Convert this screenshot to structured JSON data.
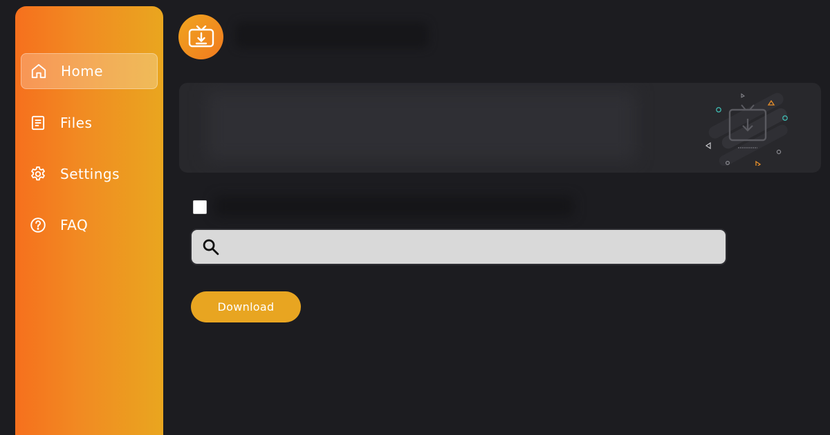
{
  "sidebar": {
    "items": [
      {
        "label": "Home",
        "icon": "home-icon",
        "active": true
      },
      {
        "label": "Files",
        "icon": "file-icon",
        "active": false
      },
      {
        "label": "Settings",
        "icon": "gear-icon",
        "active": false
      },
      {
        "label": "FAQ",
        "icon": "question-icon",
        "active": false
      }
    ]
  },
  "header": {
    "logo_icon": "tv-download-icon"
  },
  "form": {
    "search_placeholder": "",
    "search_icon": "search-icon",
    "download_label": "Download"
  },
  "colors": {
    "accent": "#e8a521",
    "sidebar_start": "#f6701d",
    "sidebar_end": "#e9a61f",
    "background": "#1c1c20",
    "banner": "#28282c"
  }
}
